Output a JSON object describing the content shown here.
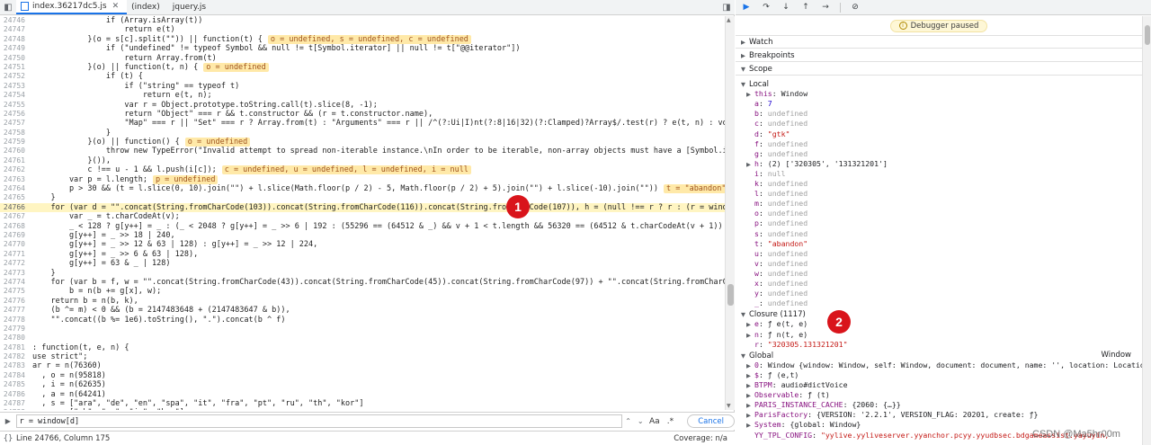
{
  "tabs": [
    {
      "label": "index.36217dc5.js",
      "active": true
    },
    {
      "label": "(index)",
      "active": false
    },
    {
      "label": "jquery.js",
      "active": false
    }
  ],
  "code_lines": [
    {
      "n": "24746",
      "t": "                if (Array.isArray(t))",
      "inline": ""
    },
    {
      "n": "24747",
      "t": "                    return e(t)",
      "inline": ""
    },
    {
      "n": "24748",
      "t": "            }(o = s[c].split(\"\")) || function(t) {",
      "inline": "o = undefined, s = undefined, c = undefined"
    },
    {
      "n": "24749",
      "t": "                if (\"undefined\" != typeof Symbol && null != t[Symbol.iterator] || null != t[\"@@iterator\"])",
      "inline": ""
    },
    {
      "n": "24750",
      "t": "                    return Array.from(t)",
      "inline": ""
    },
    {
      "n": "24751",
      "t": "            }(o) || function(t, n) {",
      "inline": "o = undefined"
    },
    {
      "n": "24752",
      "t": "                if (t) {",
      "inline": ""
    },
    {
      "n": "24753",
      "t": "                    if (\"string\" == typeof t)",
      "inline": ""
    },
    {
      "n": "24754",
      "t": "                        return e(t, n);",
      "inline": ""
    },
    {
      "n": "24755",
      "t": "                    var r = Object.prototype.toString.call(t).slice(8, -1);",
      "inline": ""
    },
    {
      "n": "24756",
      "t": "                    return \"Object\" === r && t.constructor && (r = t.constructor.name),",
      "inline": ""
    },
    {
      "n": "24757",
      "t": "                    \"Map\" === r || \"Set\" === r ? Array.from(t) : \"Arguments\" === r || /^(?:Ui|I)nt(?:8|16|32)(?:Clamped)?Array$/.test(r) ? e(t, n) : void 0",
      "inline": ""
    },
    {
      "n": "24758",
      "t": "                }",
      "inline": ""
    },
    {
      "n": "24759",
      "t": "            }(o) || function() {",
      "inline": "o = undefined"
    },
    {
      "n": "24760",
      "t": "                throw new TypeError(\"Invalid attempt to spread non-iterable instance.\\nIn order to be iterable, non-array objects must have a [Symbol.iterator]() method",
      "inline": ""
    },
    {
      "n": "24761",
      "t": "            }()),",
      "inline": ""
    },
    {
      "n": "24762",
      "t": "            c !== u - 1 && l.push(i[c]);",
      "inline": "c = undefined, u = undefined, l = undefined, i = null"
    },
    {
      "n": "24763",
      "t": "        var p = l.length;",
      "inline": "p = undefined"
    },
    {
      "n": "24764",
      "t": "        p > 30 && (t = l.slice(0, 10).join(\"\") + l.slice(Math.floor(p / 2) - 5, Math.floor(p / 2) + 5).join(\"\") + l.slice(-10).join(\"\"))",
      "inline": "t = \"abandon\""
    },
    {
      "n": "24765",
      "t": "    }",
      "inline": ""
    },
    {
      "n": "24766",
      "t": "    for (var d = \"\".concat(String.fromCharCode(103)).concat(String.fromCharCode(116)).concat(String.fromCharCode(107)), h = (null !== r ? r : (r = window[d] || \"\") || \"",
      "inline": "",
      "hl": true
    },
    {
      "n": "24767",
      "t": "        var _ = t.charCodeAt(v);",
      "inline": ""
    },
    {
      "n": "24768",
      "t": "        _ < 128 ? g[y++] = _ : (_ < 2048 ? g[y++] = _ >> 6 | 192 : (55296 == (64512 & _) && v + 1 < t.length && 56320 == (64512 & t.charCodeAt(v + 1)) ? (_ = 65536 + ((",
      "inline": ""
    },
    {
      "n": "24769",
      "t": "        g[y++] = _ >> 18 | 240,",
      "inline": ""
    },
    {
      "n": "24770",
      "t": "        g[y++] = _ >> 12 & 63 | 128) : g[y++] = _ >> 12 | 224,",
      "inline": ""
    },
    {
      "n": "24771",
      "t": "        g[y++] = _ >> 6 & 63 | 128),",
      "inline": ""
    },
    {
      "n": "24772",
      "t": "        g[y++] = 63 & _ | 128)",
      "inline": ""
    },
    {
      "n": "24773",
      "t": "    }",
      "inline": ""
    },
    {
      "n": "24774",
      "t": "    for (var b = f, w = \"\".concat(String.fromCharCode(43)).concat(String.fromCharCode(45)).concat(String.fromCharCode(97)) + \"\".concat(String.fromCharCode(94)).concat(S",
      "inline": ""
    },
    {
      "n": "24775",
      "t": "        b = n(b += g[x], w);",
      "inline": ""
    },
    {
      "n": "24776",
      "t": "    return b = n(b, k),",
      "inline": ""
    },
    {
      "n": "24777",
      "t": "    (b ^= m) < 0 && (b = 2147483648 + (2147483647 & b)),",
      "inline": ""
    },
    {
      "n": "24778",
      "t": "    \"\".concat((b %= 1e6).toString(), \".\").concat(b ^ f)",
      "inline": ""
    },
    {
      "n": "24779",
      "t": "",
      "inline": ""
    },
    {
      "n": "24780",
      "t": "",
      "inline": ""
    },
    {
      "n": "24781",
      "t": ": function(t, e, n) {",
      "inline": ""
    },
    {
      "n": "24782",
      "t": "use strict\";",
      "inline": ""
    },
    {
      "n": "24783",
      "t": "ar r = n(76360)",
      "inline": ""
    },
    {
      "n": "24784",
      "t": "  , o = n(95818)",
      "inline": ""
    },
    {
      "n": "24785",
      "t": "  , i = n(62635)",
      "inline": ""
    },
    {
      "n": "24786",
      "t": "  , a = n(64241)",
      "inline": ""
    },
    {
      "n": "24787",
      "t": "  , s = [\"ara\", \"de\", \"en\", \"spa\", \"it\", \"fra\", \"pt\", \"ru\", \"th\", \"kor\"]",
      "inline": ""
    },
    {
      "n": "24788",
      "t": "  , c = [\"zh\", \"en\", \"jp\", \"kor\"]",
      "inline": ""
    },
    {
      "n": "24789",
      "t": "  , u = [\"de\", \"spa\", \"it\", \"fra\", \"pt\"];",
      "inline": ""
    },
    {
      "n": "24790",
      "t": ".exports = {",
      "inline": ""
    },
    {
      "n": "24791",
      "t": "    getLang: function(t, e, n) {",
      "inline": ""
    },
    {
      "n": "24792",
      "t": "        return r.set(\"detectLang\", t)",
      "inline": ""
    }
  ],
  "search": {
    "value": "r = window[d]",
    "aa": "Aa",
    "regex": ".*",
    "cancel": "Cancel"
  },
  "status": {
    "position": "Line 24766, Column 175",
    "coverage": "Coverage: n/a"
  },
  "debugger": {
    "paused": "Debugger paused",
    "sections": [
      "Watch",
      "Breakpoints",
      "Scope"
    ],
    "local_label": "Local",
    "local": [
      {
        "key": "this",
        "val": "Window",
        "kind": "plain",
        "exp": true
      },
      {
        "key": "a",
        "val": "7",
        "kind": "num"
      },
      {
        "key": "b",
        "val": "undefined",
        "kind": "undef"
      },
      {
        "key": "c",
        "val": "undefined",
        "kind": "undef"
      },
      {
        "key": "d",
        "val": "\"gtk\"",
        "kind": "str"
      },
      {
        "key": "f",
        "val": "undefined",
        "kind": "undef"
      },
      {
        "key": "g",
        "val": "undefined",
        "kind": "undef"
      },
      {
        "key": "h",
        "val": "(2) ['320305', '131321201']",
        "kind": "plain",
        "exp": true
      },
      {
        "key": "i",
        "val": "null",
        "kind": "undef"
      },
      {
        "key": "k",
        "val": "undefined",
        "kind": "undef"
      },
      {
        "key": "l",
        "val": "undefined",
        "kind": "undef"
      },
      {
        "key": "m",
        "val": "undefined",
        "kind": "undef"
      },
      {
        "key": "o",
        "val": "undefined",
        "kind": "undef"
      },
      {
        "key": "p",
        "val": "undefined",
        "kind": "undef"
      },
      {
        "key": "s",
        "val": "undefined",
        "kind": "undef"
      },
      {
        "key": "t",
        "val": "\"abandon\"",
        "kind": "str"
      },
      {
        "key": "u",
        "val": "undefined",
        "kind": "undef"
      },
      {
        "key": "v",
        "val": "undefined",
        "kind": "undef"
      },
      {
        "key": "w",
        "val": "undefined",
        "kind": "undef"
      },
      {
        "key": "x",
        "val": "undefined",
        "kind": "undef"
      },
      {
        "key": "y",
        "val": "undefined",
        "kind": "undef"
      },
      {
        "key": "_",
        "val": "undefined",
        "kind": "undef"
      }
    ],
    "closure_label": "Closure (1117)",
    "closure": [
      {
        "key": "e",
        "val": "ƒ e(t, e)",
        "kind": "plain",
        "exp": true
      },
      {
        "key": "n",
        "val": "ƒ n(t, e)",
        "kind": "plain",
        "exp": true
      },
      {
        "key": "r",
        "val": "\"320305.131321201\"",
        "kind": "str"
      }
    ],
    "global_label": "Global",
    "global_right": "Window",
    "global": [
      {
        "key": "0",
        "val": "Window {window: Window, self: Window, document: document, name: '', location: Location, …}",
        "kind": "plain",
        "exp": true
      },
      {
        "key": "$",
        "val": "ƒ (e,t)",
        "kind": "plain",
        "exp": true
      },
      {
        "key": "BTPM",
        "val": "audio#dictVoice",
        "kind": "plain",
        "exp": true
      },
      {
        "key": "Observable",
        "val": "ƒ (t)",
        "kind": "plain",
        "exp": true
      },
      {
        "key": "PARIS_INSTANCE_CACHE",
        "val": "{2060: {…}}",
        "kind": "plain",
        "exp": true
      },
      {
        "key": "ParisFactory",
        "val": "{VERSION: '2.2.1', VERSION_FLAG: 20201, create: ƒ}",
        "kind": "plain",
        "exp": true
      },
      {
        "key": "System",
        "val": "{global: Window}",
        "kind": "plain",
        "exp": true
      },
      {
        "key": "YY_TPL_CONFIG",
        "val": "\"yylive.yyliveserver.yyanchor.pcyy.yyudbsec.bdgameassist.yayuyin,",
        "kind": "str"
      }
    ]
  },
  "markers": [
    "1",
    "2"
  ],
  "watermark": "CSDN @Ma5hr00m"
}
